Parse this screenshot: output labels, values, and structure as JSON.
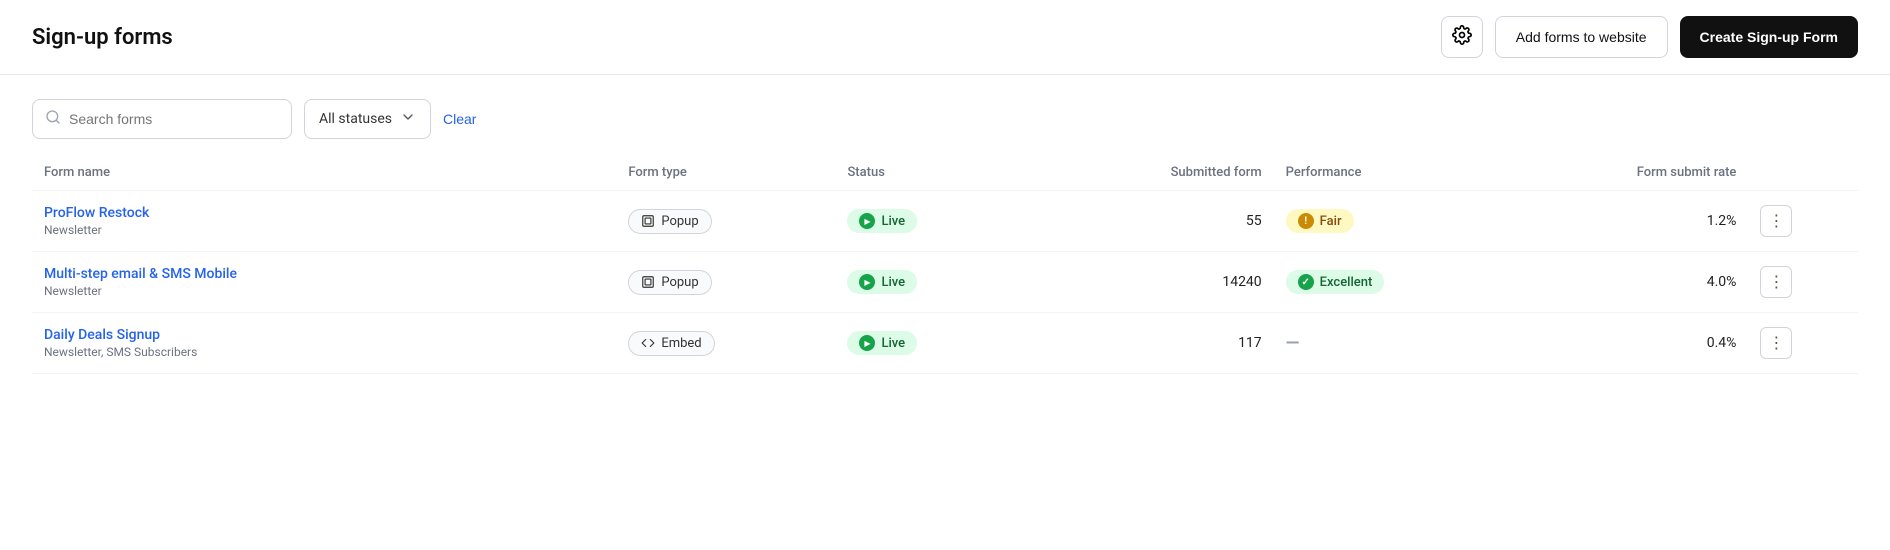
{
  "header": {
    "title": "Sign-up forms",
    "gear_icon": "⚙",
    "add_forms_label": "Add forms to website",
    "create_form_label": "Create Sign-up Form"
  },
  "toolbar": {
    "search_placeholder": "Search forms",
    "status_select_label": "All statuses",
    "clear_label": "Clear"
  },
  "table": {
    "columns": [
      {
        "key": "name",
        "label": "Form name"
      },
      {
        "key": "type",
        "label": "Form type"
      },
      {
        "key": "status",
        "label": "Status"
      },
      {
        "key": "submitted",
        "label": "Submitted form"
      },
      {
        "key": "performance",
        "label": "Performance"
      },
      {
        "key": "rate",
        "label": "Form submit rate"
      }
    ],
    "rows": [
      {
        "id": 1,
        "name": "ProFlow Restock",
        "sub": "Newsletter",
        "form_type": "Popup",
        "status": "Live",
        "submitted": "55",
        "performance": "Fair",
        "performance_variant": "fair",
        "rate": "1.2%"
      },
      {
        "id": 2,
        "name": "Multi-step email & SMS Mobile",
        "sub": "Newsletter",
        "form_type": "Popup",
        "status": "Live",
        "submitted": "14240",
        "performance": "Excellent",
        "performance_variant": "excellent",
        "rate": "4.0%"
      },
      {
        "id": 3,
        "name": "Daily Deals Signup",
        "sub": "Newsletter, SMS Subscribers",
        "form_type": "Embed",
        "status": "Live",
        "submitted": "117",
        "performance": "—",
        "performance_variant": "none",
        "rate": "0.4%"
      }
    ]
  }
}
